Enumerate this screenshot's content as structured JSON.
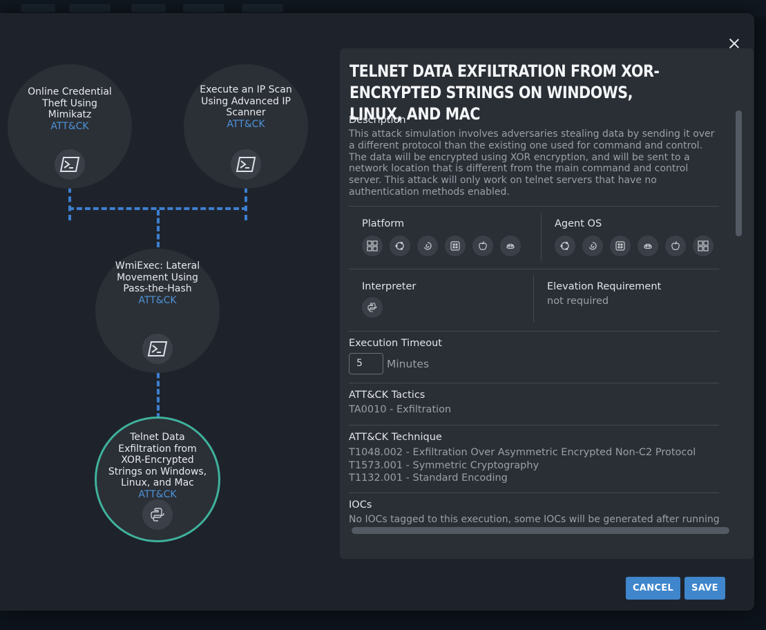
{
  "graph": {
    "nodes": [
      {
        "title": "Online Credential Theft Using Mimikatz",
        "link": "ATT&CK",
        "icon": "powershell-icon"
      },
      {
        "title": "Execute an IP Scan Using Advanced IP Scanner",
        "link": "ATT&CK",
        "icon": "powershell-icon"
      },
      {
        "title": "WmiExec: Lateral Movement Using Pass-the-Hash",
        "link": "ATT&CK",
        "icon": "powershell-icon"
      },
      {
        "title": "Telnet Data Exfiltration from XOR-Encrypted Strings on Windows, Linux, and Mac",
        "link": "ATT&CK",
        "icon": "python-icon"
      }
    ]
  },
  "detail": {
    "title": "Telnet Data Exfiltration from XOR-Encrypted Strings on Windows, Linux, and Mac",
    "description_label": "Description",
    "description": "This attack simulation involves adversaries stealing data by sending it over a different protocol than the existing one used for command and control. The data will be encrypted using XOR encryption, and will be sent to a network location that is different from the main command and control server. This attack will only work on telnet servers that have no authentication methods enabled.",
    "platform_label": "Platform",
    "platform_icons": [
      "windows-icon",
      "ubuntu-icon",
      "debian-icon",
      "redhat-icon",
      "apple-icon",
      "centos-icon"
    ],
    "agent_os_label": "Agent OS",
    "agent_os_icons": [
      "ubuntu-icon",
      "debian-icon",
      "redhat-icon",
      "centos-icon",
      "apple-icon",
      "windows-icon"
    ],
    "interpreter_label": "Interpreter",
    "interpreter_icon": "python-icon",
    "elevation_label": "Elevation Requirement",
    "elevation_value": "not required",
    "timeout_label": "Execution Timeout",
    "timeout_value": "5",
    "timeout_unit": "Minutes",
    "tactics_label": "ATT&CK Tactics",
    "tactics": [
      "TA0010 - Exfiltration"
    ],
    "technique_label": "ATT&CK Technique",
    "techniques": [
      "T1048.002 - Exfiltration Over Asymmetric Encrypted Non-C2 Protocol",
      "T1573.001 - Symmetric Cryptography",
      "T1132.001 - Standard Encoding"
    ],
    "iocs_label": "IOCs",
    "iocs_text": "No IOCs tagged to this execution, some IOCs will be generated after running this"
  },
  "buttons": {
    "cancel": "CANCEL",
    "save": "SAVE"
  },
  "colors": {
    "accent": "#3f86cc",
    "link": "#4d93d8",
    "active_ring": "#3fb29c",
    "dash": "#3d7fd0"
  }
}
